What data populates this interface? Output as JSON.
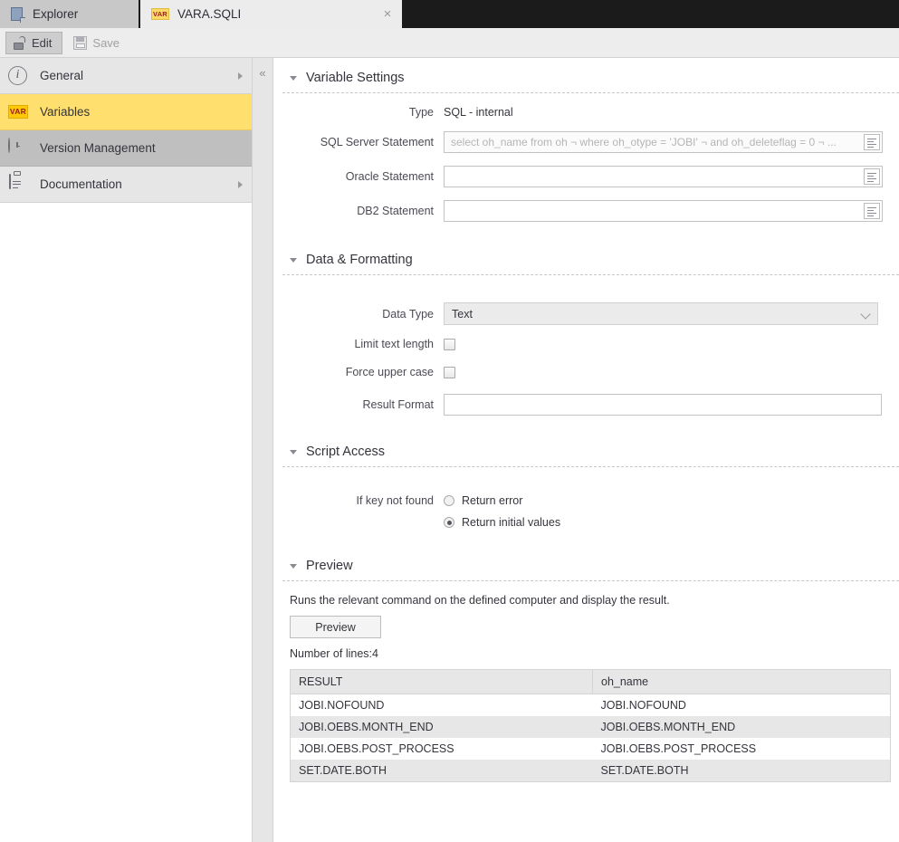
{
  "tabs": [
    {
      "label": "Explorer",
      "icon": "page-icon",
      "active": false
    },
    {
      "label": "VARA.SQLI",
      "icon": "var-badge-icon",
      "badge": "VAR",
      "active": true,
      "close": "×"
    }
  ],
  "toolbar": {
    "edit_label": "Edit",
    "save_label": "Save"
  },
  "sidebar": {
    "collapse_glyph": "«",
    "items": [
      {
        "label": "General",
        "icon": "info-icon",
        "state": "normal",
        "arrow": true
      },
      {
        "label": "Variables",
        "icon": "var-icon",
        "badge": "VAR",
        "state": "selected-yellow",
        "arrow": false
      },
      {
        "label": "Version Management",
        "icon": "clock-icon",
        "state": "selected-gray",
        "arrow": false
      },
      {
        "label": "Documentation",
        "icon": "clipboard-icon",
        "state": "normal",
        "arrow": true
      }
    ]
  },
  "main": {
    "variable_settings": {
      "title": "Variable Settings",
      "type_label": "Type",
      "type_value": "SQL - internal",
      "sql_server_label": "SQL Server Statement",
      "sql_server_value": "select oh_name from oh  ¬ where oh_otype = 'JOBI'  ¬ and oh_deleteflag = 0  ¬ ...",
      "oracle_label": "Oracle Statement",
      "oracle_value": "",
      "db2_label": "DB2 Statement",
      "db2_value": ""
    },
    "data_formatting": {
      "title": "Data & Formatting",
      "data_type_label": "Data Type",
      "data_type_value": "Text",
      "limit_text_length_label": "Limit text length",
      "limit_text_length_checked": false,
      "force_upper_case_label": "Force upper case",
      "force_upper_case_checked": false,
      "result_format_label": "Result Format",
      "result_format_value": ""
    },
    "script_access": {
      "title": "Script Access",
      "if_key_not_found_label": "If key not found",
      "option_return_error": "Return error",
      "option_return_initial": "Return initial values",
      "selected": "Return initial values"
    },
    "preview": {
      "title": "Preview",
      "description": "Runs the relevant command on the defined computer and display the result.",
      "button_label": "Preview",
      "lines_label": "Number of lines:4",
      "table": {
        "columns": [
          "RESULT",
          "oh_name"
        ],
        "rows": [
          [
            "JOBI.NOFOUND",
            "JOBI.NOFOUND"
          ],
          [
            "JOBI.OEBS.MONTH_END",
            "JOBI.OEBS.MONTH_END"
          ],
          [
            "JOBI.OEBS.POST_PROCESS",
            "JOBI.OEBS.POST_PROCESS"
          ],
          [
            "SET.DATE.BOTH",
            "SET.DATE.BOTH"
          ]
        ]
      }
    }
  },
  "colors": {
    "accent_yellow": "#ffdf6e",
    "tab_bar": "#1b1b1b",
    "selected_gray": "#bfbfbf",
    "var_badge_text": "#9b1c21"
  }
}
